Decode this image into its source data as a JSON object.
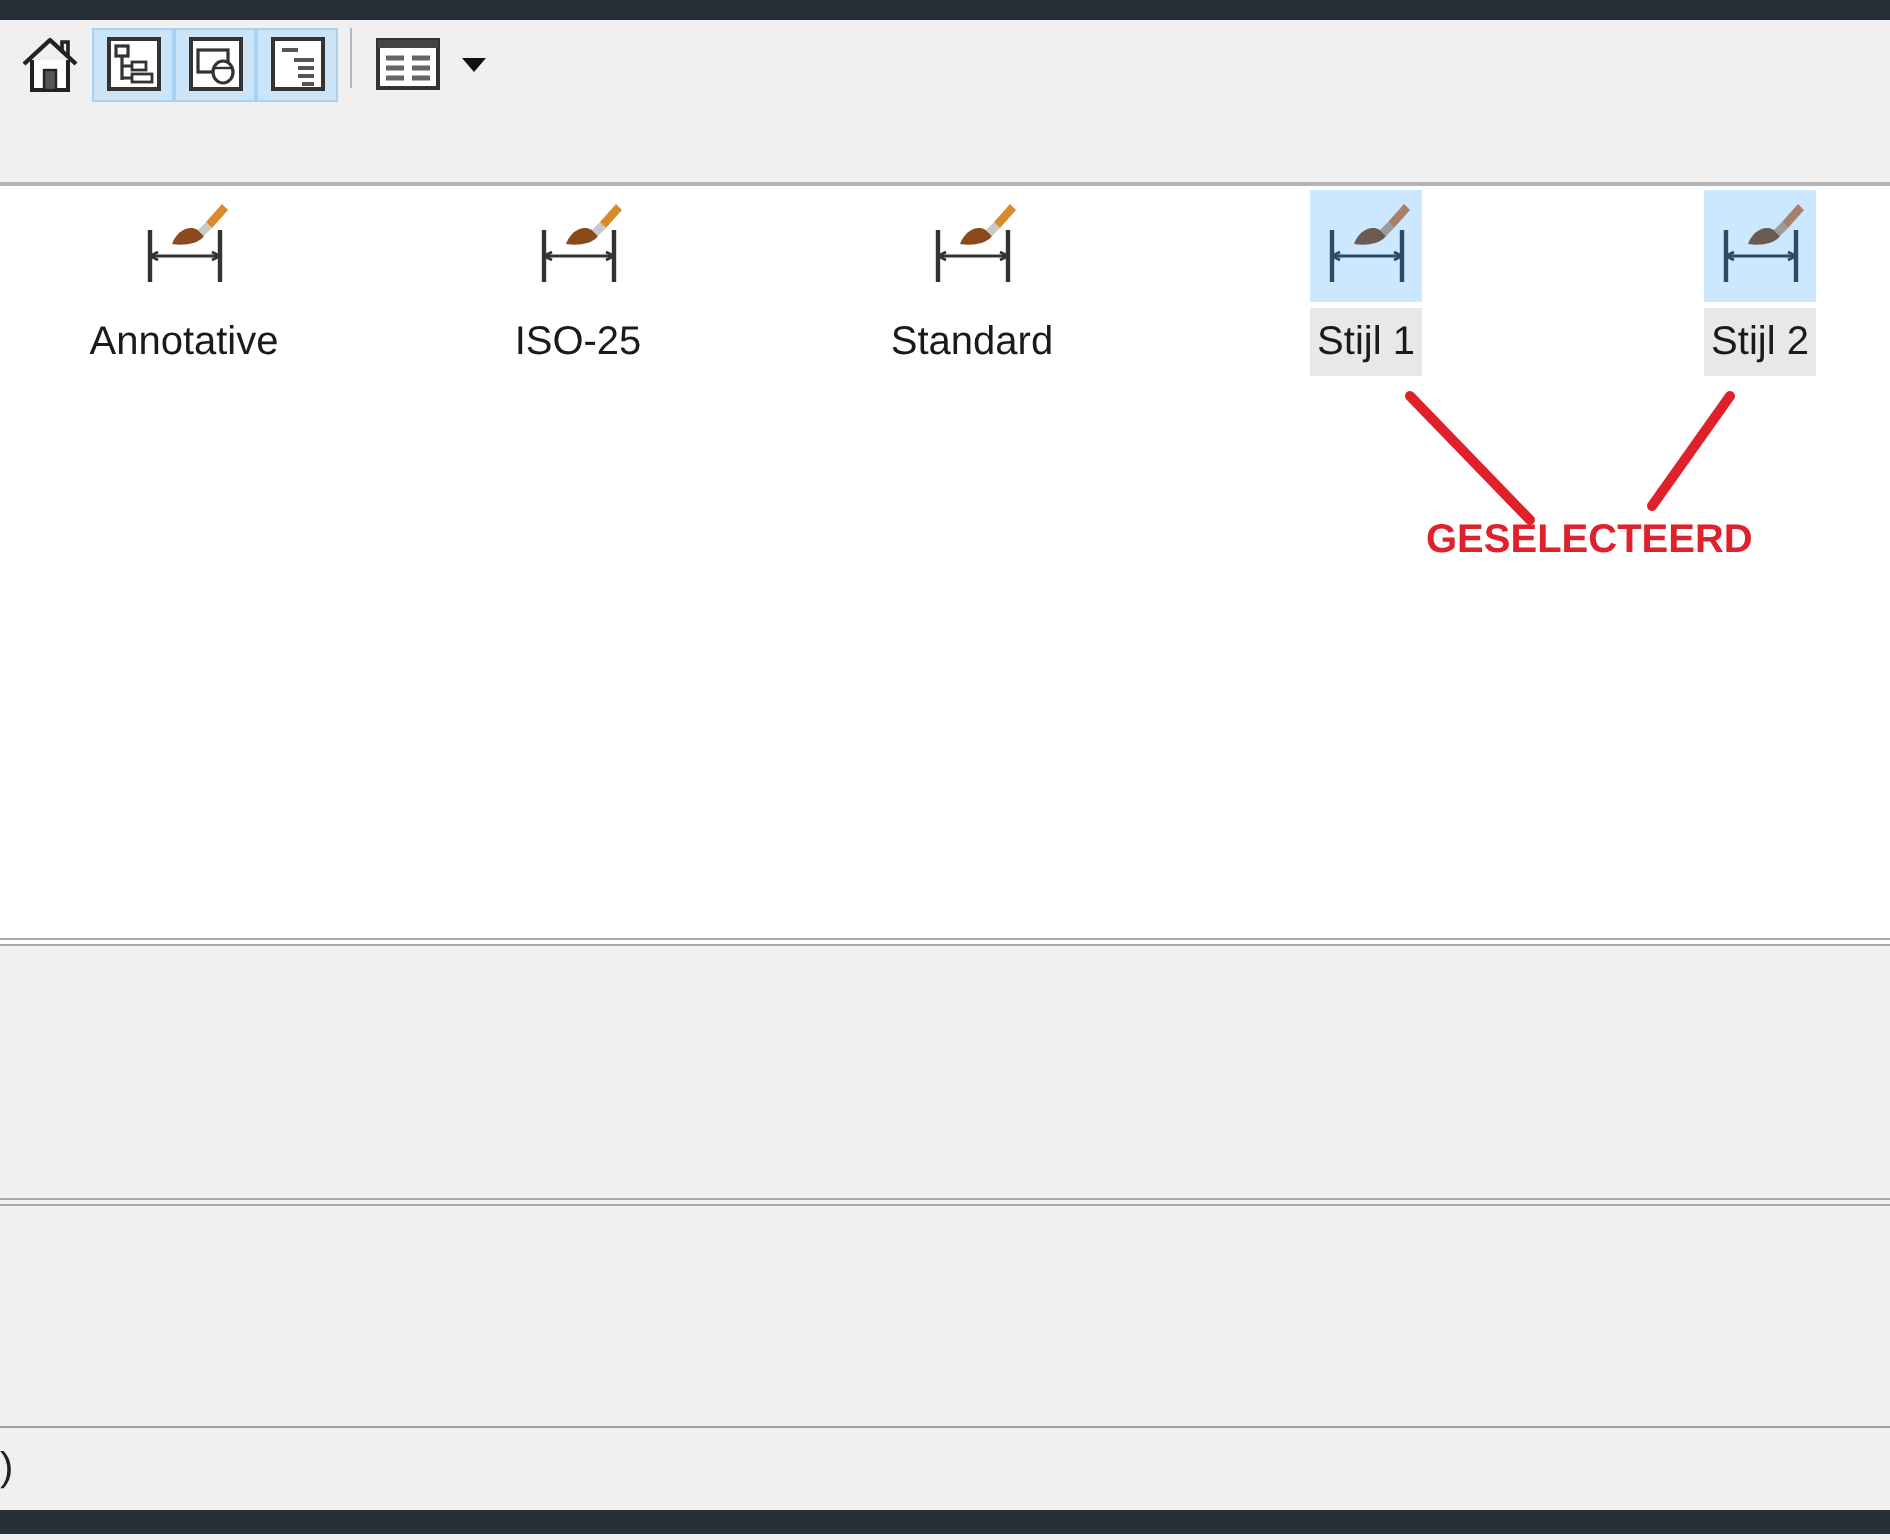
{
  "toolbar": {
    "buttons": [
      {
        "kind": "home",
        "on": false
      },
      {
        "kind": "tree",
        "on": true
      },
      {
        "kind": "preview",
        "on": true
      },
      {
        "kind": "list",
        "on": true
      }
    ]
  },
  "styles": [
    {
      "name": "Annotative",
      "selected": false
    },
    {
      "name": "ISO-25",
      "selected": false
    },
    {
      "name": "Standard",
      "selected": false
    },
    {
      "name": "Stijl 1",
      "selected": true
    },
    {
      "name": "Stijl 2",
      "selected": true
    }
  ],
  "annotation": {
    "label": "GESELECTEERD"
  },
  "status_bar": {
    "text": ")"
  }
}
